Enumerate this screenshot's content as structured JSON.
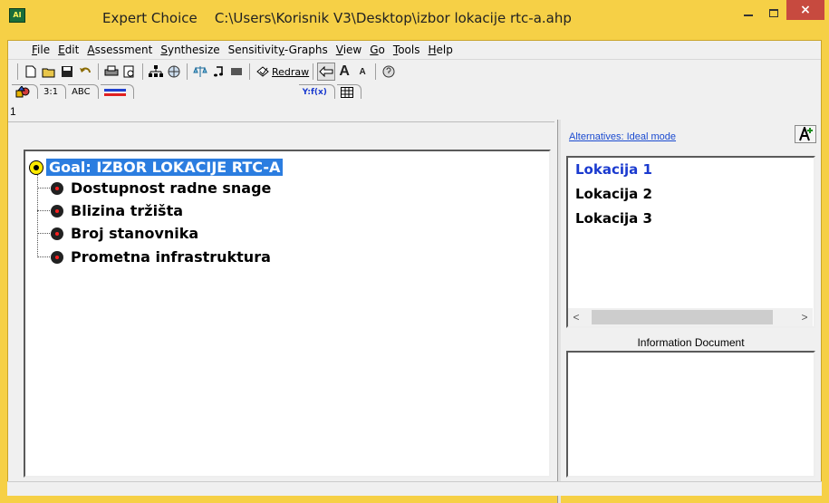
{
  "window": {
    "app_name": "Expert Choice",
    "file_path": "C:\\Users\\Korisnik V3\\Desktop\\izbor lokacije rtc-a.ahp",
    "close_glyph": "×"
  },
  "menu": [
    {
      "u": "F",
      "rest": "ile"
    },
    {
      "u": "E",
      "rest": "dit"
    },
    {
      "u": "A",
      "rest": "ssessment"
    },
    {
      "u": "S",
      "rest": "ynthesize"
    },
    {
      "pre": "Sensitivit",
      "u": "y",
      "rest": "-Graphs"
    },
    {
      "u": "V",
      "rest": "iew"
    },
    {
      "u": "G",
      "rest": "o"
    },
    {
      "u": "T",
      "rest": "ools"
    },
    {
      "u": "H",
      "rest": "elp"
    }
  ],
  "toolbar": {
    "redraw_label": "Redraw",
    "icons": [
      "new-file-icon",
      "open-folder-icon",
      "save-icon",
      "undo-icon",
      "print-icon",
      "print-preview-icon",
      "tree-icon",
      "globe-icon",
      "scales-icon",
      "music-note-icon",
      "gray-bar-icon",
      "redraw-icon",
      "pointer-icon",
      "font-larger-icon",
      "font-smaller-icon",
      "help-icon"
    ]
  },
  "tabs": {
    "t1": "3:1",
    "t2": "ABC",
    "t4": "Y:f(x)"
  },
  "left": {
    "header_text": "1",
    "goal": "Goal: IZBOR LOKACIJE RTC-A",
    "criteria": [
      "Dostupnost radne snage",
      "Blizina tržišta",
      "Broj stanovnika",
      "Prometna infrastruktura"
    ]
  },
  "right": {
    "link": "Alternatives: Ideal mode",
    "alternatives": [
      "Lokacija 1",
      "Lokacija 2",
      "Lokacija 3"
    ],
    "info_label": "Information Document"
  },
  "colors": {
    "frame": "#f6d046",
    "goal_highlight": "#2b7de0",
    "active_alternative": "#1a3acf",
    "link": "#1a4ad0"
  }
}
